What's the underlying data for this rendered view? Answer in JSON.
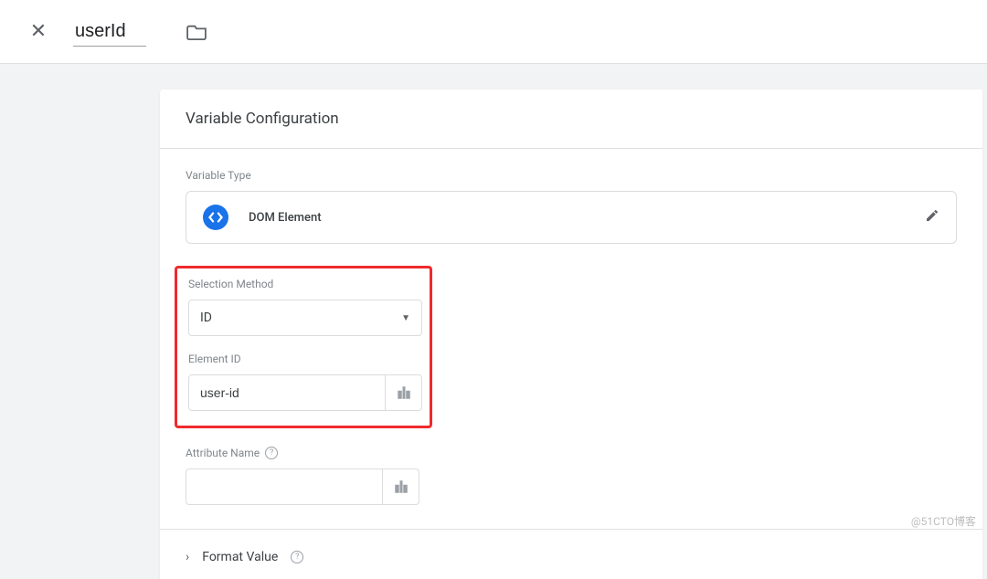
{
  "header": {
    "variable_name": "userId"
  },
  "panel": {
    "title": "Variable Configuration",
    "var_type_label": "Variable Type",
    "var_type_name": "DOM Element",
    "selection_method_label": "Selection Method",
    "selection_method_value": "ID",
    "element_id_label": "Element ID",
    "element_id_value": "user-id",
    "attribute_name_label": "Attribute Name",
    "attribute_name_value": "",
    "format_value_label": "Format Value"
  },
  "watermark": "@51CTO博客"
}
